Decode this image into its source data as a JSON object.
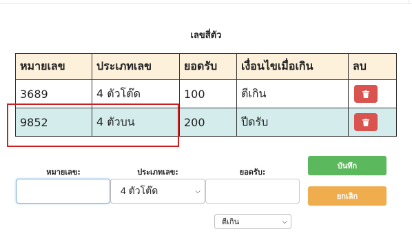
{
  "section_title": "เลขสี่ตัว",
  "table": {
    "headers": [
      "หมายเลข",
      "ประเภทเลข",
      "ยอดรับ",
      "เงื่อนไขเมื่อเกิน",
      "ลบ"
    ],
    "rows": [
      {
        "number": "3689",
        "type": "4 ตัวโต๊ด",
        "amount": "100",
        "condition": "ตีเกิน"
      },
      {
        "number": "9852",
        "type": "4 ตัวบน",
        "amount": "200",
        "condition": "ปีดรับ"
      }
    ]
  },
  "form": {
    "number_label": "หมายเลข:",
    "number_value": "",
    "type_label": "ประเภทเลข:",
    "type_selected": "4 ตัวโต๊ด",
    "amount_label": "ยอดรับ:",
    "amount_value": "",
    "condition_selected": "ตีเกิน",
    "save_label": "บันทึก",
    "cancel_label": "ยกเลิก"
  },
  "colors": {
    "header_bg": "#fdf1db",
    "highlight_row_bg": "#d4ecec",
    "delete_button": "#d9534f",
    "save_button": "#5cb85c",
    "cancel_button": "#f0ad4e",
    "annotation_box": "#cc1f1f"
  },
  "icons": {
    "delete": "trash-icon",
    "dropdown": "chevron-down-icon"
  }
}
